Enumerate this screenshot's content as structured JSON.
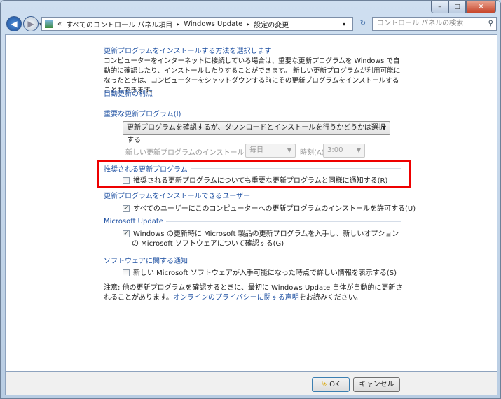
{
  "window": {
    "minimize": "–",
    "maximize": "□",
    "close": "✕"
  },
  "nav": {
    "back": "◀",
    "forward": "▶",
    "dropdown": "▾"
  },
  "breadcrumb": {
    "overflow": "«",
    "items": [
      "すべてのコントロール パネル項目",
      "Windows Update",
      "設定の変更"
    ],
    "sep": "▸",
    "dropdown": "▾"
  },
  "refresh": "↻",
  "search": {
    "placeholder": "コントロール パネルの検索",
    "icon": "⚲"
  },
  "main": {
    "title": "更新プログラムをインストールする方法を選択します",
    "description": "コンピューターをインターネットに接続している場合は、重要な更新プログラムを Windows で自動的に確認したり、インストールしたりすることができます。 新しい更新プログラムが利用可能になったときは、コンピューターをシャットダウンする前にその更新プログラムをインストールすることもできます。",
    "benefits_link": "自動更新の利点",
    "important": {
      "heading": "重要な更新プログラム(I)",
      "selected": "更新プログラムを確認するが、ダウンロードとインストールを行うかどうかは選択する",
      "install_label": "新しい更新プログラムのインストール(N):",
      "day": "毎日",
      "time_label": "時刻(A)",
      "time": "3:00"
    },
    "recommended": {
      "heading": "推奨される更新プログラム",
      "checkbox": "推奨される更新プログラムについても重要な更新プログラムと同様に通知する(R)",
      "checked": false
    },
    "who": {
      "heading": "更新プログラムをインストールできるユーザー",
      "checkbox": "すべてのユーザーにこのコンピューターへの更新プログラムのインストールを許可する(U)",
      "checked": true
    },
    "microsoft_update": {
      "heading": "Microsoft Update",
      "checkbox": "Windows の更新時に Microsoft 製品の更新プログラムを入手し、新しいオプションの Microsoft ソフトウェアについて確認する(G)",
      "checked": true
    },
    "software": {
      "heading": "ソフトウェアに関する通知",
      "checkbox": "新しい Microsoft ソフトウェアが入手可能になった時点で詳しい情報を表示する(S)",
      "checked": false
    },
    "note_prefix": "注意: 他の更新プログラムを確認するときに、最初に Windows Update 自体が自動的に更新されることがあります。",
    "privacy_link": "オンラインのプライバシーに関する声明",
    "note_suffix": "をお読みください。"
  },
  "buttons": {
    "ok": "OK",
    "cancel": "キャンセル"
  }
}
